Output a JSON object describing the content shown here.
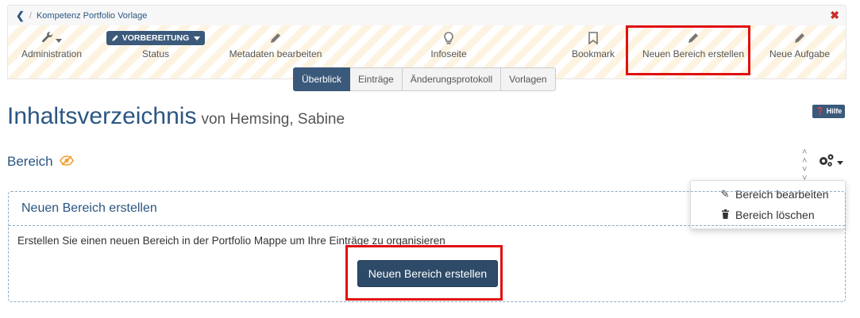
{
  "breadcrumb": {
    "back_icon": "chevron-left",
    "separator": "/",
    "title": "Kompetenz Portfolio Vorlage",
    "close_icon": "close"
  },
  "toolbar": {
    "administration": "Administration",
    "status_badge": "VORBEREITUNG",
    "status": "Status",
    "metadata": "Metadaten bearbeiten",
    "infopage": "Infoseite",
    "bookmark": "Bookmark",
    "new_section": "Neuen Bereich erstellen",
    "new_task": "Neue Aufgabe"
  },
  "tabs": [
    "Überblick",
    "Einträge",
    "Änderungsprotokoll",
    "Vorlagen"
  ],
  "page": {
    "title": "Inhaltsverzeichnis",
    "subtitle": "von Hemsing, Sabine",
    "help": "Hilfe"
  },
  "section": {
    "title": "Bereich"
  },
  "menu": {
    "edit": "Bereich bearbeiten",
    "delete": "Bereich löschen"
  },
  "panel": {
    "heading": "Neuen Bereich erstellen",
    "text": "Erstellen Sie einen neuen Bereich in der Portfolio Mappe um Ihre Einträge zu organisieren",
    "button": "Neuen Bereich erstellen"
  },
  "colors": {
    "primary": "#2b5683",
    "button": "#2d4a68",
    "highlight": "#e01010",
    "stripe": "#fdf3e1"
  }
}
